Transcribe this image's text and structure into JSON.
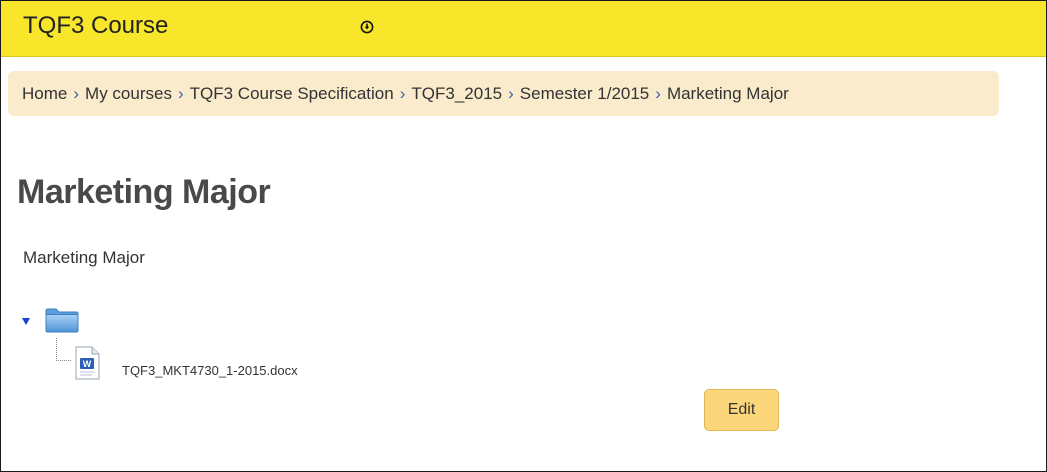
{
  "header": {
    "site_title": "TQF3 Course",
    "menu_icon": "circle-down-arrow-icon"
  },
  "breadcrumb": {
    "items": [
      {
        "label": "Home"
      },
      {
        "label": "My courses"
      },
      {
        "label": "TQF3 Course Specification"
      },
      {
        "label": "TQF3_2015"
      },
      {
        "label": "Semester 1/2015"
      },
      {
        "label": "Marketing Major"
      }
    ],
    "separator": "›",
    "separator_color": "#3a5fa8"
  },
  "main": {
    "title": "Marketing Major",
    "intro": "Marketing Major",
    "folder_tree": {
      "folder_icon": "folder-icon",
      "expanded": true,
      "files": [
        {
          "name": "TQF3_MKT4730_1-2015.docx",
          "icon": "word-document-icon"
        }
      ]
    },
    "edit_label": "Edit"
  },
  "colors": {
    "header_bg": "#f7e62a",
    "breadcrumb_bg": "#faebcc",
    "button_bg": "#fbd67b",
    "title_color": "#494949"
  }
}
